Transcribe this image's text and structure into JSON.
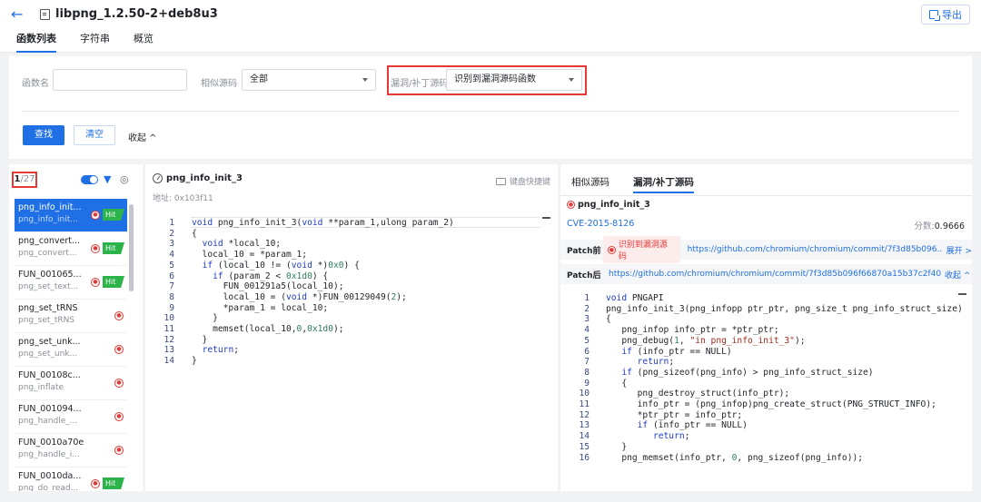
{
  "header": {
    "title": "libpng_1.2.50-2+deb8u3",
    "export_label": "导出"
  },
  "tabs": [
    {
      "label": "函数列表"
    },
    {
      "label": "字符串"
    },
    {
      "label": "概览"
    }
  ],
  "filter": {
    "func_name_label": "函数名",
    "func_name_value": "",
    "similar_label": "相似源码",
    "similar_value": "全部",
    "vuln_label": "漏洞/补丁源码",
    "vuln_value": "识别到漏洞源码函数",
    "search_label": "查找",
    "clear_label": "清空",
    "collapse_label": "收起 ^"
  },
  "left": {
    "counter_current": "1",
    "counter_total": "/27",
    "functions": [
      {
        "name": "png_info_init...",
        "sub": "png_info_init...",
        "hit": "Hit"
      },
      {
        "name": "png_convert...",
        "sub": "png_convert...",
        "hit": "Hit"
      },
      {
        "name": "FUN_001065...",
        "sub": "png_set_text...",
        "hit": "Hit"
      },
      {
        "name": "png_set_tRNS",
        "sub": "png_set_tRNS",
        "hit": ""
      },
      {
        "name": "png_set_unk...",
        "sub": "png_set_unk...",
        "hit": ""
      },
      {
        "name": "FUN_00108c...",
        "sub": "png_inflate",
        "hit": ""
      },
      {
        "name": "FUN_001094...",
        "sub": "png_handle_...",
        "hit": ""
      },
      {
        "name": "FUN_0010a70e",
        "sub": "png_handle_i...",
        "hit": ""
      },
      {
        "name": "FUN_0010da...",
        "sub": "png_do_read...",
        "hit": "Hit"
      }
    ]
  },
  "middle": {
    "func_title": "png_info_init_3",
    "address": "地址: 0x103f11",
    "shortcut_label": "键盘快捷键",
    "code": [
      [
        [
          "kw",
          "void"
        ],
        [
          "t",
          " png_info_init_3("
        ],
        [
          "kw",
          "void"
        ],
        [
          "t",
          " **param_1,ulong param_2)"
        ]
      ],
      [
        [
          "t",
          "{"
        ]
      ],
      [
        [
          "t",
          "  "
        ],
        [
          "kw",
          "void"
        ],
        [
          "t",
          " *local_10;"
        ]
      ],
      [
        [
          "t",
          "  local_10 = *param_1;"
        ]
      ],
      [
        [
          "t",
          "  "
        ],
        [
          "kw",
          "if"
        ],
        [
          "t",
          " (local_10 != ("
        ],
        [
          "kw",
          "void"
        ],
        [
          "t",
          " *)"
        ],
        [
          "num",
          "0x0"
        ],
        [
          "t",
          ") {"
        ]
      ],
      [
        [
          "t",
          "    "
        ],
        [
          "kw",
          "if"
        ],
        [
          "t",
          " (param_2 < "
        ],
        [
          "num",
          "0x1d0"
        ],
        [
          "t",
          ") {"
        ]
      ],
      [
        [
          "t",
          "      FUN_001291a5(local_10);"
        ]
      ],
      [
        [
          "t",
          "      local_10 = ("
        ],
        [
          "kw",
          "void"
        ],
        [
          "t",
          " *)FUN_00129049("
        ],
        [
          "num",
          "2"
        ],
        [
          "t",
          ");"
        ]
      ],
      [
        [
          "t",
          "      *param_1 = local_10;"
        ]
      ],
      [
        [
          "t",
          "    }"
        ]
      ],
      [
        [
          "t",
          "    memset(local_10,"
        ],
        [
          "num",
          "0"
        ],
        [
          "t",
          ","
        ],
        [
          "num",
          "0x1d0"
        ],
        [
          "t",
          ");"
        ]
      ],
      [
        [
          "t",
          "  }"
        ]
      ],
      [
        [
          "t",
          "  "
        ],
        [
          "kw",
          "return"
        ],
        [
          "t",
          ";"
        ]
      ],
      [
        [
          "t",
          "}"
        ]
      ]
    ]
  },
  "right": {
    "tabs": [
      {
        "label": "相似源码"
      },
      {
        "label": "漏洞/补丁源码"
      }
    ],
    "func_name": "png_info_init_3",
    "cve": "CVE-2015-8126",
    "score_label": "分数:",
    "score_value": "0.9666",
    "patch_before_label": "Patch前",
    "patch_before_tag": "识别到漏洞源码",
    "patch_before_link": "https://github.com/chromium/chromium/commit/7f3d85b096...",
    "patch_before_action": "展开 >",
    "patch_after_label": "Patch后",
    "patch_after_link": "https://github.com/chromium/chromium/commit/7f3d85b096f66870a15b37c2f40...",
    "patch_after_action": "收起 ^",
    "code": [
      [
        [
          "kw",
          "void"
        ],
        [
          "t",
          " PNGAPI"
        ]
      ],
      [
        [
          "t",
          "png_info_init_3(png_infopp ptr_ptr, png_size_t png_info_struct_size)"
        ]
      ],
      [
        [
          "t",
          "{"
        ]
      ],
      [
        [
          "t",
          "   png_infop info_ptr = *ptr_ptr;"
        ]
      ],
      [
        [
          "t",
          "   png_debug("
        ],
        [
          "num",
          "1"
        ],
        [
          "t",
          ", "
        ],
        [
          "str",
          "\"in png_info_init_3\""
        ],
        [
          "t",
          ");"
        ]
      ],
      [
        [
          "t",
          "   "
        ],
        [
          "kw",
          "if"
        ],
        [
          "t",
          " (info_ptr == NULL)"
        ]
      ],
      [
        [
          "t",
          "      "
        ],
        [
          "kw",
          "return"
        ],
        [
          "t",
          ";"
        ]
      ],
      [
        [
          "t",
          "   "
        ],
        [
          "kw",
          "if"
        ],
        [
          "t",
          " (png_sizeof(png_info) > png_info_struct_size)"
        ]
      ],
      [
        [
          "t",
          "   {"
        ]
      ],
      [
        [
          "t",
          "      png_destroy_struct(info_ptr);"
        ]
      ],
      [
        [
          "t",
          "      info_ptr = (png_infop)png_create_struct(PNG_STRUCT_INFO);"
        ]
      ],
      [
        [
          "t",
          "      *ptr_ptr = info_ptr;"
        ]
      ],
      [
        [
          "t",
          "      "
        ],
        [
          "kw",
          "if"
        ],
        [
          "t",
          " (info_ptr == NULL)"
        ]
      ],
      [
        [
          "t",
          "         "
        ],
        [
          "kw",
          "return"
        ],
        [
          "t",
          ";"
        ]
      ],
      [
        [
          "t",
          "   }"
        ]
      ],
      [
        [
          "t",
          "   png_memset(info_ptr, "
        ],
        [
          "num",
          "0"
        ],
        [
          "t",
          ", png_sizeof(png_info));"
        ]
      ]
    ]
  }
}
